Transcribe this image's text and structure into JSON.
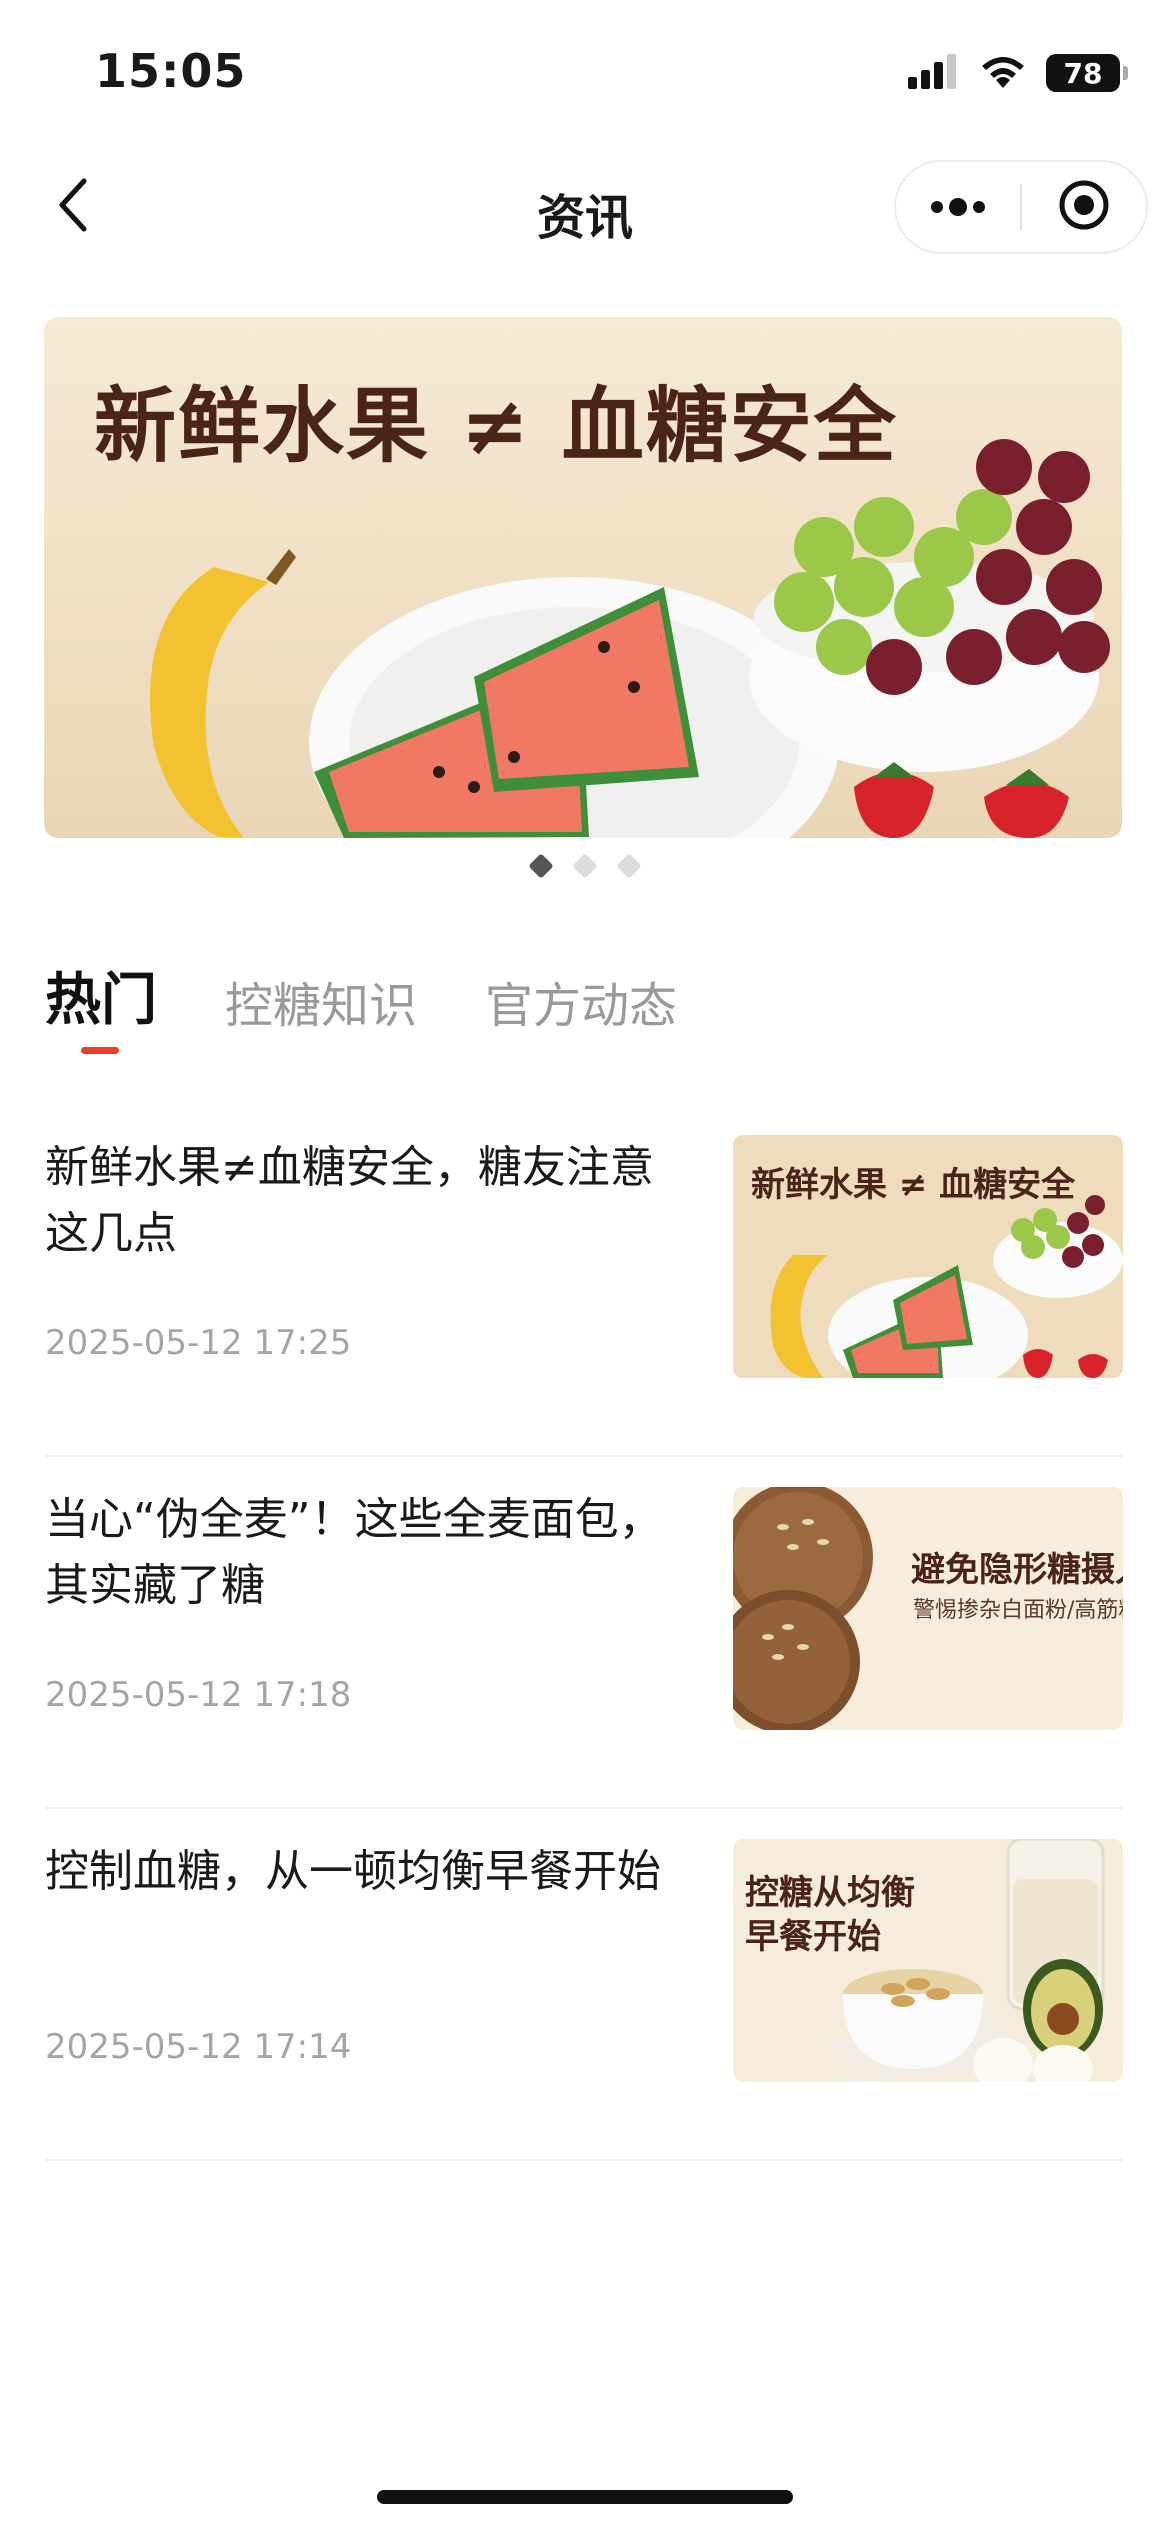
{
  "status_bar": {
    "time": "15:05",
    "battery": "78",
    "icons": [
      "signal-icon",
      "wifi-icon",
      "battery-icon"
    ]
  },
  "nav": {
    "title": "资讯",
    "back_icon": "chevron-left-icon",
    "more_icon": "more-dots-icon",
    "close_icon": "target-circle-icon"
  },
  "banner": {
    "text": "新鲜水果 ≠ 血糖安全",
    "slides": 3,
    "active_slide": 1
  },
  "tabs": [
    {
      "label": "热门",
      "active": true
    },
    {
      "label": "控糖知识",
      "active": false
    },
    {
      "label": "官方动态",
      "active": false
    }
  ],
  "articles": [
    {
      "title": "新鲜水果≠血糖安全，糖友注意这几点",
      "time": "2025-05-12 17:25",
      "thumb_text": "新鲜水果 ≠ 血糖安全"
    },
    {
      "title": "当心“伪全麦”！这些全麦面包，其实藏了糖",
      "time": "2025-05-12 17:18",
      "thumb_text": "避免隐形糖摄人",
      "thumb_subtext": "警惕掺杂白面粉/高筋粉"
    },
    {
      "title": "控制血糖，从一顿均衡早餐开始",
      "time": "2025-05-12 17:14",
      "thumb_text": "控糖从均衡",
      "thumb_text2": "早餐开始"
    }
  ],
  "colors": {
    "accent": "#e8402a",
    "text_primary": "#1a1a1a",
    "text_secondary": "#9a9a9a",
    "banner_bg": "#f2e4c8",
    "banner_text": "#4a2418"
  }
}
